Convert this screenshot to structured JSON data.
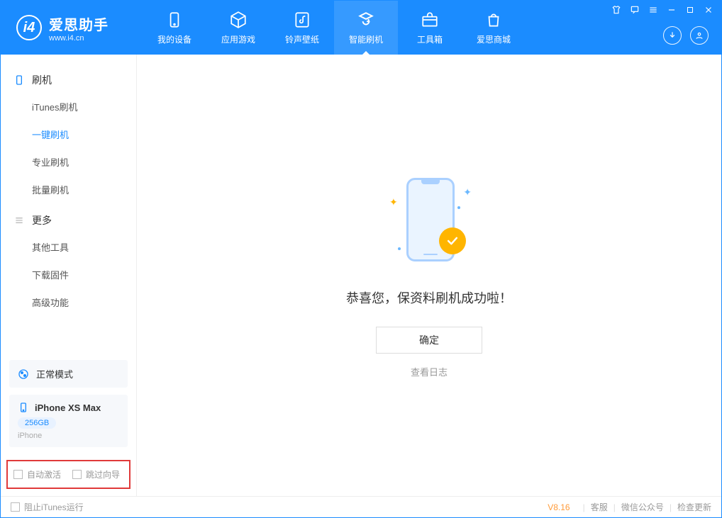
{
  "app": {
    "title": "爱思助手",
    "subtitle": "www.i4.cn"
  },
  "nav": {
    "items": [
      {
        "label": "我的设备"
      },
      {
        "label": "应用游戏"
      },
      {
        "label": "铃声壁纸"
      },
      {
        "label": "智能刷机"
      },
      {
        "label": "工具箱"
      },
      {
        "label": "爱思商城"
      }
    ]
  },
  "sidebar": {
    "group1": {
      "title": "刷机",
      "items": [
        "iTunes刷机",
        "一键刷机",
        "专业刷机",
        "批量刷机"
      ]
    },
    "group2": {
      "title": "更多",
      "items": [
        "其他工具",
        "下载固件",
        "高级功能"
      ]
    },
    "status": {
      "mode": "正常模式"
    },
    "device": {
      "name": "iPhone XS Max",
      "capacity": "256GB",
      "type": "iPhone"
    },
    "options": {
      "auto_activate": "自动激活",
      "skip_guide": "跳过向导"
    }
  },
  "main": {
    "success_text": "恭喜您，保资料刷机成功啦！",
    "ok_button": "确定",
    "view_log": "查看日志"
  },
  "footer": {
    "block_itunes": "阻止iTunes运行",
    "version": "V8.16",
    "links": [
      "客服",
      "微信公众号",
      "检查更新"
    ]
  }
}
